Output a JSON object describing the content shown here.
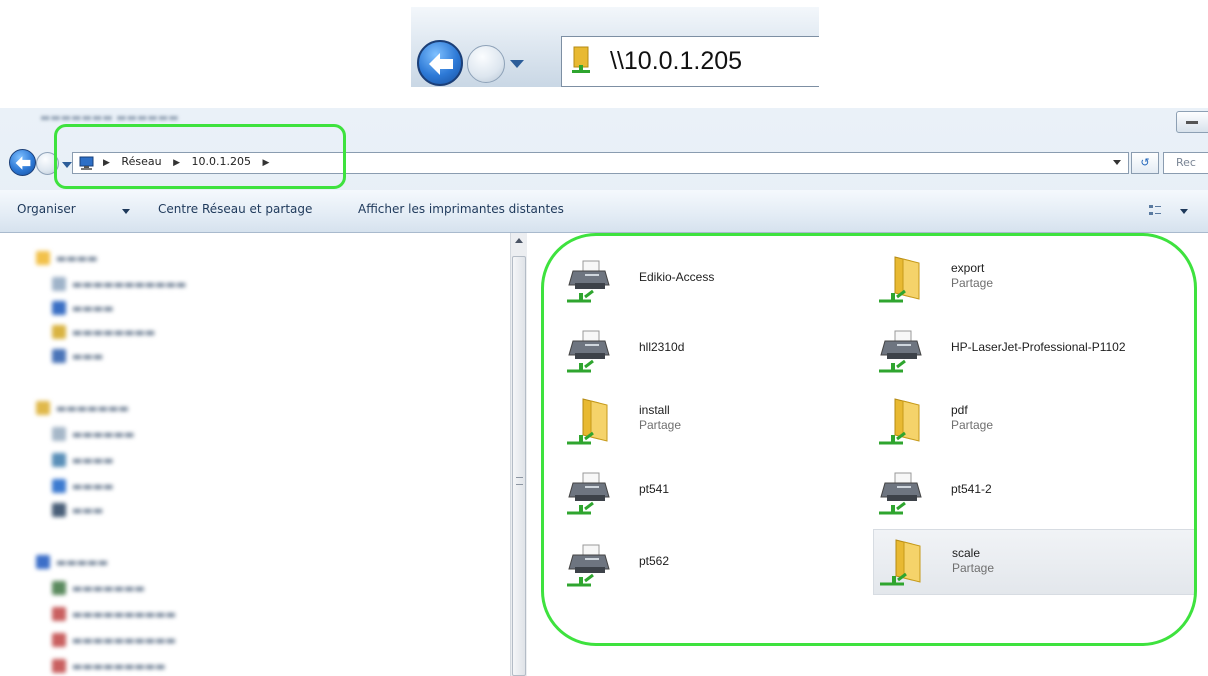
{
  "inset": {
    "address_text": "\\\\10.0.1.205",
    "icons": [
      "back-arrow-icon",
      "forward-arrow-icon",
      "network-share-icon"
    ]
  },
  "window": {
    "address": {
      "crumbs": [
        "Réseau",
        "10.0.1.205"
      ],
      "search_placeholder": "Rec"
    },
    "toolbar": {
      "organize": "Organiser",
      "network_center": "Centre Réseau et partage",
      "remote_printers": "Afficher les imprimantes distantes"
    },
    "items": [
      {
        "name": "Edikio-Access",
        "sub": "",
        "type": "printer"
      },
      {
        "name": "export",
        "sub": "Partage",
        "type": "share"
      },
      {
        "name": "hll2310d",
        "sub": "",
        "type": "printer"
      },
      {
        "name": "HP-LaserJet-Professional-P1102",
        "sub": "",
        "type": "printer"
      },
      {
        "name": "install",
        "sub": "Partage",
        "type": "share"
      },
      {
        "name": "pdf",
        "sub": "Partage",
        "type": "share"
      },
      {
        "name": "pt541",
        "sub": "",
        "type": "printer"
      },
      {
        "name": "pt541-2",
        "sub": "",
        "type": "printer"
      },
      {
        "name": "pt562",
        "sub": "",
        "type": "printer"
      },
      {
        "name": "scale",
        "sub": "Partage",
        "type": "share"
      }
    ],
    "highlight_color": "#3ee23e",
    "nav_color": "#6c7d92"
  }
}
